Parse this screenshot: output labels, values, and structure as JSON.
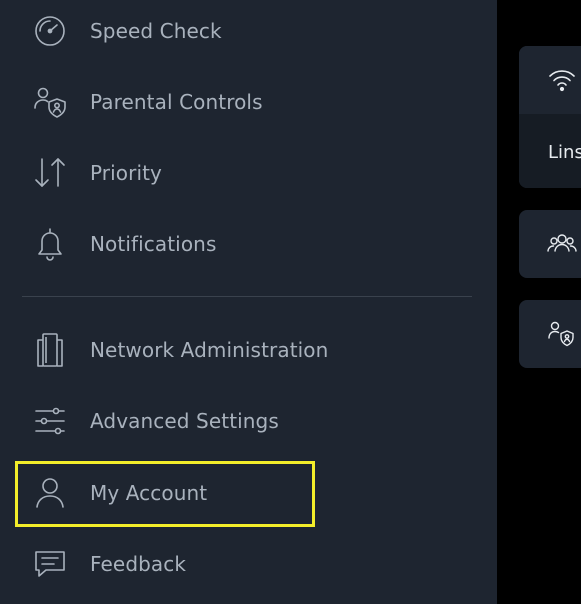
{
  "menu": {
    "items": [
      {
        "label": "Speed Check",
        "icon": "speedometer-icon"
      },
      {
        "label": "Parental Controls",
        "icon": "parental-controls-icon"
      },
      {
        "label": "Priority",
        "icon": "priority-arrows-icon"
      },
      {
        "label": "Notifications",
        "icon": "bell-icon"
      },
      {
        "label": "Network Administration",
        "icon": "network-admin-icon"
      },
      {
        "label": "Advanced Settings",
        "icon": "sliders-icon"
      },
      {
        "label": "My Account",
        "icon": "user-icon"
      },
      {
        "label": "Feedback",
        "icon": "chat-bubble-icon"
      }
    ],
    "selected": "My Account"
  },
  "cards": {
    "wifi": {
      "icon": "wifi-icon",
      "text": "Lins"
    },
    "devices": {
      "icon": "devices-group-icon"
    },
    "parental": {
      "icon": "parental-controls-icon"
    }
  },
  "colors": {
    "drawer_bg": "#1e2530",
    "label": "#a9b2bd",
    "highlight": "#f3ed2a",
    "background": "#000000"
  }
}
